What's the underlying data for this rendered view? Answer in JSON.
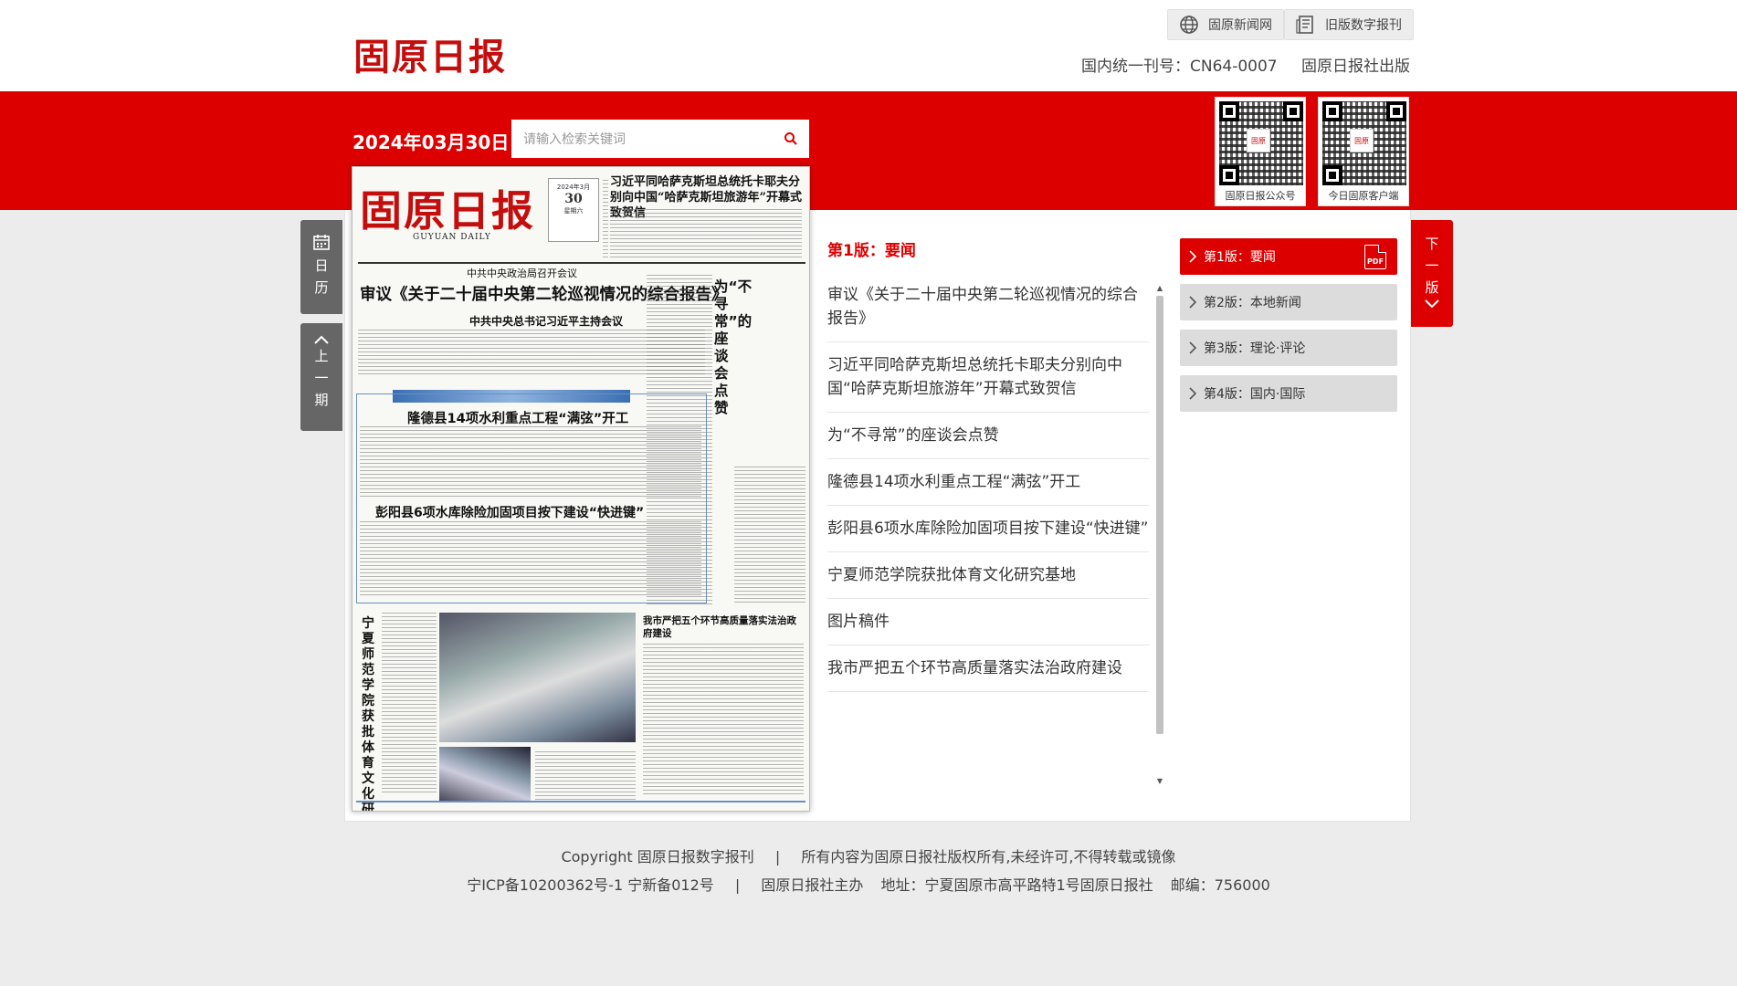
{
  "header": {
    "logo": "固原日报",
    "buttons": [
      {
        "label": "固原新闻网",
        "icon": "globe-icon"
      },
      {
        "label": "旧版数字报刊",
        "icon": "newspaper-icon"
      }
    ],
    "issn": "国内统一刊号：CN64-0007",
    "publisher": "固原日报社出版"
  },
  "toolbar": {
    "date": "2024年03月30日",
    "search_placeholder": "请输入检索关键词"
  },
  "qr_codes": [
    {
      "label": "固原日报公众号",
      "logo": "固原"
    },
    {
      "label": "今日固原客户端",
      "logo": "固原"
    }
  ],
  "side_nav": {
    "calendar": [
      "日",
      "历"
    ],
    "prev": [
      "上",
      "一",
      "期"
    ],
    "next": [
      "下",
      "一",
      "版"
    ]
  },
  "paper": {
    "logo": "固原日报",
    "daily": "GUYUAN DAILY",
    "date_box": {
      "month": "2024年3月",
      "day": "30",
      "weekday": "星期六"
    },
    "headline_top": "习近平同哈萨克斯坦总统托卡耶夫分别向中国“哈萨克斯坦旅游年”开幕式致贺信",
    "kicker": "中共中央政治局召开会议",
    "headline_main": "审议《关于二十届中央第二轮巡视情况的综合报告》",
    "subhead": "中共中央总书记习近平主持会议",
    "headline_water": "隆德县14项水利重点工程“满弦”开工",
    "headline_reservoir": "彭阳县6项水库除险加固项目按下建设“快进键”",
    "vertical_left": "宁夏师范学院获批体育文化研究基地",
    "vertical_right": "为“不寻常”的座谈会点赞",
    "headline_gov": "我市严把五个环节高质量落实法治政府建设"
  },
  "section": {
    "title": "第1版：要闻",
    "articles": [
      "审议《关于二十届中央第二轮巡视情况的综合报告》",
      "习近平同哈萨克斯坦总统托卡耶夫分别向中国“哈萨克斯坦旅游年”开幕式致贺信",
      "为“不寻常”的座谈会点赞",
      "隆德县14项水利重点工程“满弦”开工",
      "彭阳县6项水库除险加固项目按下建设“快进键”",
      "宁夏师范学院获批体育文化研究基地",
      "图片稿件",
      "我市严把五个环节高质量落实法治政府建设"
    ]
  },
  "pages": [
    {
      "label": "第1版：要闻",
      "active": true,
      "pdf": "PDF"
    },
    {
      "label": "第2版：本地新闻",
      "active": false
    },
    {
      "label": "第3版：理论·评论",
      "active": false
    },
    {
      "label": "第4版：国内·国际",
      "active": false
    }
  ],
  "footer": {
    "copyright": "Copyright 固原日报数字报刊",
    "rights": "所有内容为固原日报社版权所有,未经许可,不得转载或镜像",
    "icp": "宁ICP备10200362号-1 宁新备012号",
    "sponsor": "固原日报社主办",
    "address": "地址：宁夏固原市高平路特1号固原日报社",
    "postcode": "邮编：756000",
    "divider": "|"
  },
  "colors": {
    "brand_red": "#dd0000",
    "logo_red": "#c40d0d",
    "nav_gray": "#666666"
  }
}
